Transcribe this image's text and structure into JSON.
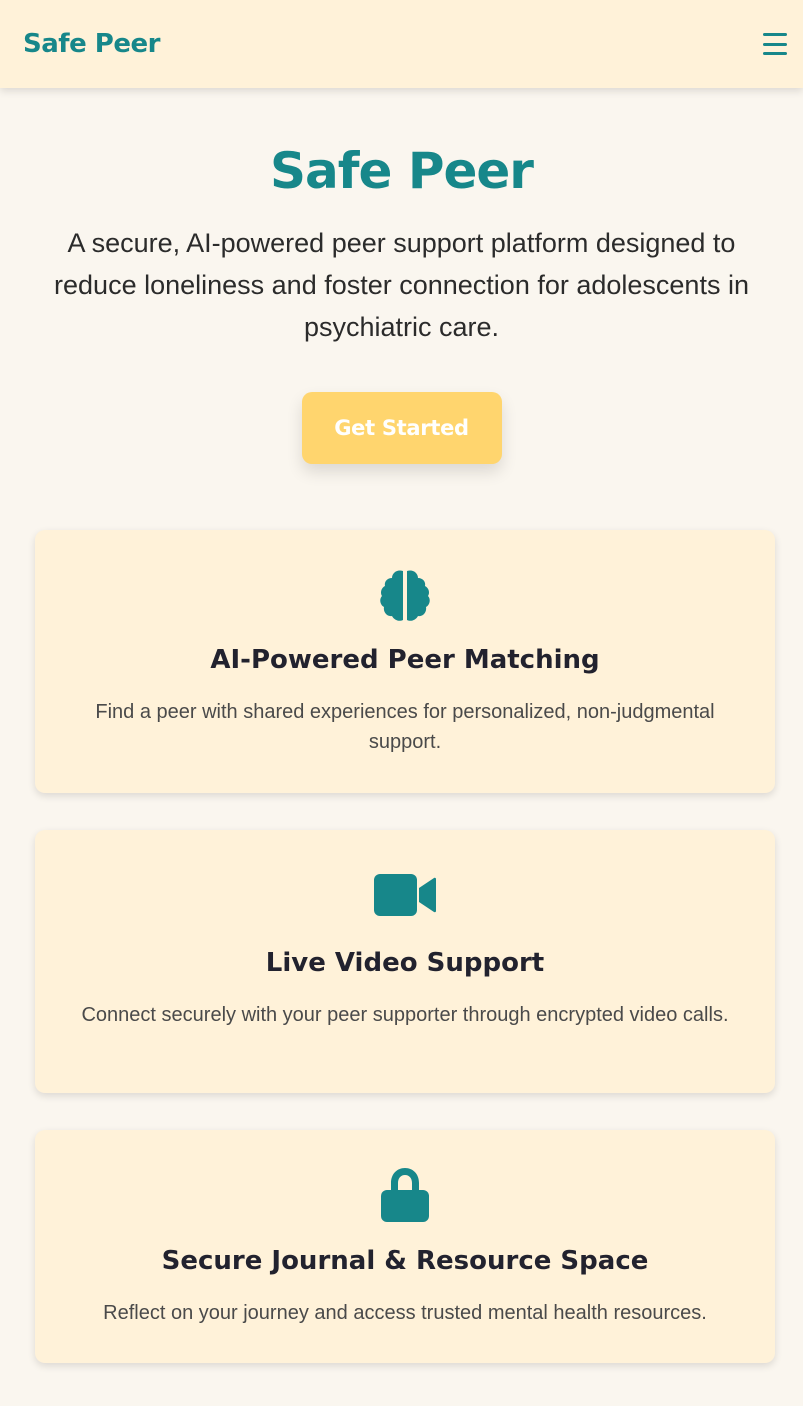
{
  "nav": {
    "brand": "Safe Peer",
    "menu_icon": "hamburger-menu-icon"
  },
  "hero": {
    "title": "Safe Peer",
    "subtitle": "A secure, AI-powered peer support platform designed to reduce loneliness and foster connection for adolescents in psychiatric care.",
    "cta_label": "Get Started"
  },
  "features": [
    {
      "icon": "brain-icon",
      "title": "AI-Powered Peer Matching",
      "description": "Find a peer with shared experiences for personalized, non-judgmental support."
    },
    {
      "icon": "video-camera-icon",
      "title": "Live Video Support",
      "description": "Connect securely with your peer supporter through encrypted video calls."
    },
    {
      "icon": "lock-icon",
      "title": "Secure Journal & Resource Space",
      "description": "Reflect on your journey and access trusted mental health resources."
    }
  ],
  "colors": {
    "brand_teal": "#17878a",
    "header_bg": "#fff2d9",
    "page_bg": "#faf6ef",
    "cta_yellow": "#ffd56e",
    "card_bg": "#fff2d9"
  }
}
